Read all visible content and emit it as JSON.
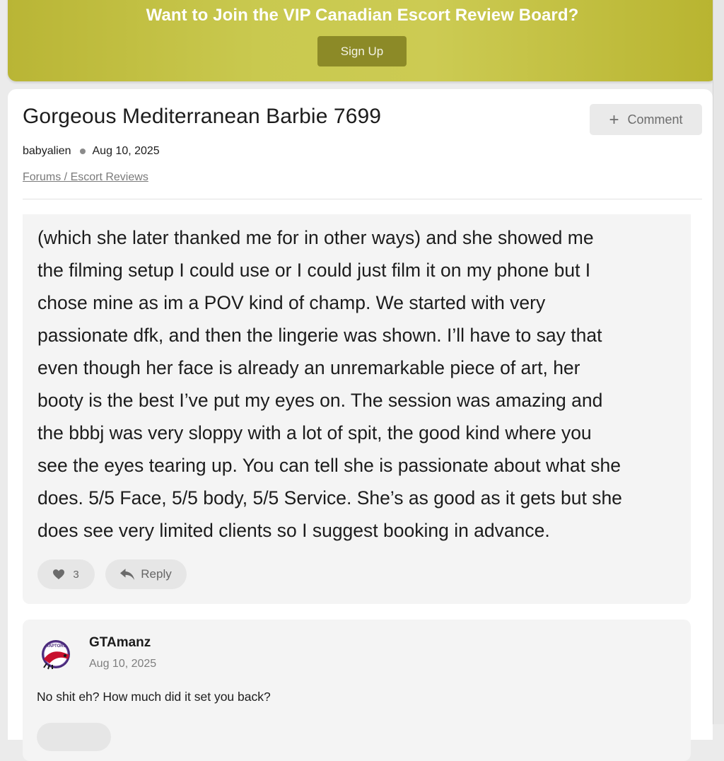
{
  "banner": {
    "title": "Want to Join the VIP Canadian Escort Review Board?",
    "signup_label": "Sign Up",
    "color": "#c9c94f",
    "button_color": "#8c8a27"
  },
  "thread": {
    "title": "Gorgeous Mediterranean Barbie 7699",
    "comment_label": "Comment",
    "comment_icon": "plus-icon",
    "author": "babyalien",
    "date": "Aug 10, 2025",
    "breadcrumb": "Forums / Escort Reviews"
  },
  "post": {
    "lines": [
      "(which she later thanked me for in other ways) and she showed me",
      "the filming setup I could use or I could just film it on my phone but I",
      "chose mine as im a POV kind of champ. We started with very",
      "passionate dfk, and then the lingerie was shown. I’ll have to say that",
      "even though her face is already an unremarkable piece of art, her",
      "booty is the best I’ve put my eyes on. The session was amazing and",
      "the bbbj was very sloppy with a lot of spit, the good kind where you",
      "see the eyes tearing up. You can tell she is passionate about what she",
      "does. 5/5 Face, 5/5 body, 5/5 Service. She’s as good as it gets but she",
      "does see very limited clients so I suggest booking in advance."
    ],
    "like_count": "3",
    "like_icon": "heart-icon",
    "reply_label": "Reply",
    "reply_icon": "reply-arrow-icon"
  },
  "reply": {
    "username": "GTAmanz",
    "date": "Aug 10, 2025",
    "text": "No shit eh? How much did it set you back?",
    "avatar_icon": "raptors-logo-avatar",
    "avatar_text": "RAPTORS"
  }
}
